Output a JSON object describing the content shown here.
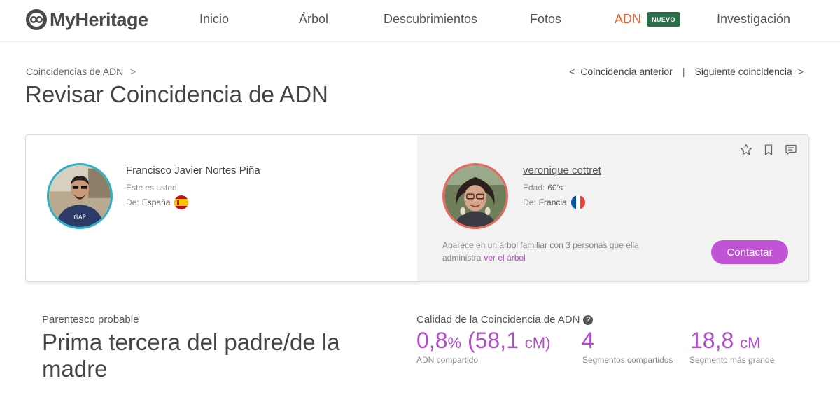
{
  "header": {
    "logo_text": "MyHeritage",
    "nav": [
      {
        "label": "Inicio"
      },
      {
        "label": "Árbol"
      },
      {
        "label": "Descubrimientos"
      },
      {
        "label": "Fotos"
      },
      {
        "label": "ADN",
        "active": true
      },
      {
        "label": "Investigación"
      }
    ],
    "new_badge": "NUEVO",
    "accent_color": "#f05a28"
  },
  "breadcrumb": {
    "parent": "Coincidencias de ADN",
    "separator": ">"
  },
  "match_nav": {
    "prev_chevron": "<",
    "prev": "Coincidencia anterior",
    "divider": "|",
    "next": "Siguiente coincidencia",
    "next_chevron": ">"
  },
  "page_title": "Revisar Coincidencia de ADN",
  "self": {
    "name": "Francisco Javier Nortes Piña",
    "subtitle": "Este es usted",
    "from_label": "De:",
    "country": "España",
    "flag_icon": "spain-flag-icon",
    "ring_color": "#2ab0c7"
  },
  "match": {
    "name": "veronique cottret",
    "age_label": "Edad:",
    "age": "60's",
    "from_label": "De:",
    "country": "Francia",
    "flag_icon": "france-flag-icon",
    "ring_color": "#e8675a",
    "tree_note": "Aparece en un árbol familiar con 3 personas que ella administra",
    "tree_link": "ver el árbol",
    "contact_label": "Contactar",
    "icons": [
      "star-icon",
      "bookmark-icon",
      "comment-icon"
    ]
  },
  "relationship": {
    "label": "Parentesco probable",
    "value": "Prima tercera del padre/de la madre"
  },
  "quality": {
    "label": "Calidad de la Coincidencia de ADN",
    "help": "?",
    "stats": [
      {
        "value": "0,8",
        "unit": "%",
        "extra": "(58,1",
        "extra_unit": "cM)",
        "caption": "ADN compartido"
      },
      {
        "value": "4",
        "caption": "Segmentos compartidos"
      },
      {
        "value": "18,8",
        "unit": "cM",
        "caption": "Segmento más grande"
      }
    ],
    "accent_color": "#b24dc8"
  }
}
